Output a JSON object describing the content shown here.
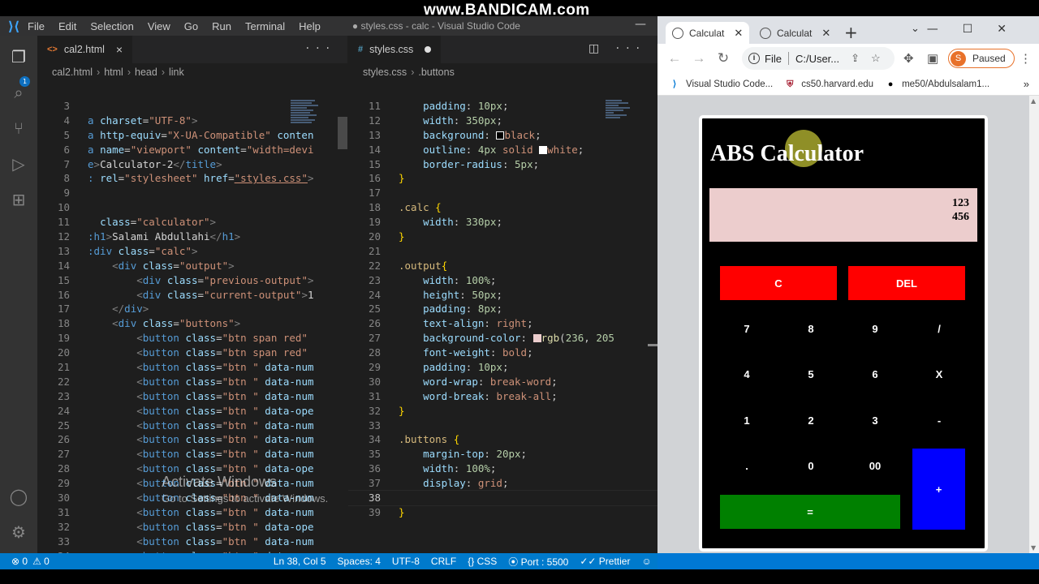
{
  "watermark": "www.BANDICAM.com",
  "vscode": {
    "menu": [
      "File",
      "Edit",
      "Selection",
      "View",
      "Go",
      "Run",
      "Terminal",
      "Help"
    ],
    "title": "● styles.css - calc - Visual Studio Code",
    "explorer_badge": "1",
    "left_editor": {
      "tab_label": "cal2.html",
      "breadcrumb": [
        "cal2.html",
        "html",
        "head",
        "link"
      ],
      "lines": [
        {
          "n": "3",
          "html": ""
        },
        {
          "n": "4",
          "html": "<span style='color:#569cd6'>a</span> <span style='color:#9cdcfe'>charset</span>=<span style='color:#ce9178'>\"UTF-8\"</span><span style='color:#808080'>&gt;</span>"
        },
        {
          "n": "5",
          "html": "<span style='color:#569cd6'>a</span> <span style='color:#9cdcfe'>http-equiv</span>=<span style='color:#ce9178'>\"X-UA-Compatible\"</span> <span style='color:#9cdcfe'>conten</span>"
        },
        {
          "n": "6",
          "html": "<span style='color:#569cd6'>a</span> <span style='color:#9cdcfe'>name</span>=<span style='color:#ce9178'>\"viewport\"</span> <span style='color:#9cdcfe'>content</span>=<span style='color:#ce9178'>\"width=devi</span>"
        },
        {
          "n": "7",
          "html": "<span style='color:#569cd6'>e</span><span style='color:#808080'>&gt;</span><span style='color:#d4d4d4'>Calculator-2</span><span style='color:#808080'>&lt;/</span><span style='color:#569cd6'>title</span><span style='color:#808080'>&gt;</span>"
        },
        {
          "n": "8",
          "html": "<span style='color:#569cd6'>:</span> <span style='color:#9cdcfe'>rel</span>=<span style='color:#ce9178'>\"stylesheet\"</span> <span style='color:#9cdcfe'>href</span>=<span style='color:#ce9178;text-decoration:underline'>\"styles.css\"</span><span style='color:#808080'>&gt;</span>"
        },
        {
          "n": "9",
          "html": ""
        },
        {
          "n": "10",
          "html": ""
        },
        {
          "n": "11",
          "html": "  <span style='color:#9cdcfe'>class</span>=<span style='color:#ce9178'>\"calculator\"</span><span style='color:#808080'>&gt;</span>"
        },
        {
          "n": "12",
          "html": "<span style='color:#569cd6'>:h1</span><span style='color:#808080'>&gt;</span><span style='color:#d4d4d4'>Salami Abdullahi</span><span style='color:#808080'>&lt;/</span><span style='color:#569cd6'>h1</span><span style='color:#808080'>&gt;</span>"
        },
        {
          "n": "13",
          "html": "<span style='color:#569cd6'>:div</span> <span style='color:#9cdcfe'>class</span>=<span style='color:#ce9178'>\"calc\"</span><span style='color:#808080'>&gt;</span>"
        },
        {
          "n": "14",
          "html": "    <span style='color:#808080'>&lt;</span><span style='color:#569cd6'>div</span> <span style='color:#9cdcfe'>class</span>=<span style='color:#ce9178'>\"output\"</span><span style='color:#808080'>&gt;</span>"
        },
        {
          "n": "15",
          "html": "        <span style='color:#808080'>&lt;</span><span style='color:#569cd6'>div</span> <span style='color:#9cdcfe'>class</span>=<span style='color:#ce9178'>\"previous-output\"</span><span style='color:#808080'>&gt;</span>"
        },
        {
          "n": "16",
          "html": "        <span style='color:#808080'>&lt;</span><span style='color:#569cd6'>div</span> <span style='color:#9cdcfe'>class</span>=<span style='color:#ce9178'>\"current-output\"</span><span style='color:#808080'>&gt;</span><span style='color:#d4d4d4'>1</span>"
        },
        {
          "n": "17",
          "html": "    <span style='color:#808080'>&lt;/</span><span style='color:#569cd6'>div</span><span style='color:#808080'>&gt;</span>"
        },
        {
          "n": "18",
          "html": "    <span style='color:#808080'>&lt;</span><span style='color:#569cd6'>div</span> <span style='color:#9cdcfe'>class</span>=<span style='color:#ce9178'>\"buttons\"</span><span style='color:#808080'>&gt;</span>"
        },
        {
          "n": "19",
          "html": "        <span style='color:#808080'>&lt;</span><span style='color:#569cd6'>button</span> <span style='color:#9cdcfe'>class</span>=<span style='color:#ce9178'>\"btn span red\"</span>"
        },
        {
          "n": "20",
          "html": "        <span style='color:#808080'>&lt;</span><span style='color:#569cd6'>button</span> <span style='color:#9cdcfe'>class</span>=<span style='color:#ce9178'>\"btn span red\"</span>"
        },
        {
          "n": "21",
          "html": "        <span style='color:#808080'>&lt;</span><span style='color:#569cd6'>button</span> <span style='color:#9cdcfe'>class</span>=<span style='color:#ce9178'>\"btn \"</span> <span style='color:#9cdcfe'>data-num</span>"
        },
        {
          "n": "22",
          "html": "        <span style='color:#808080'>&lt;</span><span style='color:#569cd6'>button</span> <span style='color:#9cdcfe'>class</span>=<span style='color:#ce9178'>\"btn \"</span> <span style='color:#9cdcfe'>data-num</span>"
        },
        {
          "n": "23",
          "html": "        <span style='color:#808080'>&lt;</span><span style='color:#569cd6'>button</span> <span style='color:#9cdcfe'>class</span>=<span style='color:#ce9178'>\"btn \"</span> <span style='color:#9cdcfe'>data-num</span>"
        },
        {
          "n": "24",
          "html": "        <span style='color:#808080'>&lt;</span><span style='color:#569cd6'>button</span> <span style='color:#9cdcfe'>class</span>=<span style='color:#ce9178'>\"btn \"</span> <span style='color:#9cdcfe'>data-ope</span>"
        },
        {
          "n": "25",
          "html": "        <span style='color:#808080'>&lt;</span><span style='color:#569cd6'>button</span> <span style='color:#9cdcfe'>class</span>=<span style='color:#ce9178'>\"btn \"</span> <span style='color:#9cdcfe'>data-num</span>"
        },
        {
          "n": "26",
          "html": "        <span style='color:#808080'>&lt;</span><span style='color:#569cd6'>button</span> <span style='color:#9cdcfe'>class</span>=<span style='color:#ce9178'>\"btn \"</span> <span style='color:#9cdcfe'>data-num</span>"
        },
        {
          "n": "27",
          "html": "        <span style='color:#808080'>&lt;</span><span style='color:#569cd6'>button</span> <span style='color:#9cdcfe'>class</span>=<span style='color:#ce9178'>\"btn \"</span> <span style='color:#9cdcfe'>data-num</span>"
        },
        {
          "n": "28",
          "html": "        <span style='color:#808080'>&lt;</span><span style='color:#569cd6'>button</span> <span style='color:#9cdcfe'>class</span>=<span style='color:#ce9178'>\"btn \"</span> <span style='color:#9cdcfe'>data-ope</span>"
        },
        {
          "n": "29",
          "html": "        <span style='color:#808080'>&lt;</span><span style='color:#569cd6'>button</span> <span style='color:#9cdcfe'>class</span>=<span style='color:#ce9178'>\"btn \"</span> <span style='color:#9cdcfe'>data-num</span>"
        },
        {
          "n": "30",
          "html": "        <span style='color:#808080'>&lt;</span><span style='color:#569cd6'>button</span> <span style='color:#9cdcfe'>class</span>=<span style='color:#ce9178'>\"btn \"</span> <span style='color:#9cdcfe'>data-num</span>"
        },
        {
          "n": "31",
          "html": "        <span style='color:#808080'>&lt;</span><span style='color:#569cd6'>button</span> <span style='color:#9cdcfe'>class</span>=<span style='color:#ce9178'>\"btn \"</span> <span style='color:#9cdcfe'>data-num</span>"
        },
        {
          "n": "32",
          "html": "        <span style='color:#808080'>&lt;</span><span style='color:#569cd6'>button</span> <span style='color:#9cdcfe'>class</span>=<span style='color:#ce9178'>\"btn \"</span> <span style='color:#9cdcfe'>data-ope</span>"
        },
        {
          "n": "33",
          "html": "        <span style='color:#808080'>&lt;</span><span style='color:#569cd6'>button</span> <span style='color:#9cdcfe'>class</span>=<span style='color:#ce9178'>\"btn \"</span> <span style='color:#9cdcfe'>data-num</span>"
        },
        {
          "n": "34",
          "html": "        <span style='color:#808080'>&lt;</span><span style='color:#569cd6'>button</span> <span style='color:#9cdcfe'>class</span>=<span style='color:#ce9178'>\"btn \"</span> <span style='color:#9cdcfe'>data-num</span>"
        },
        {
          "n": "35",
          "html": "        <span style='color:#808080'>&lt;</span><span style='color:#569cd6'>button</span> <span style='color:#9cdcfe'>class</span>=<span style='color:#ce9178'>\"btn \"</span> <span style='color:#9cdcfe'>data-num</span>"
        }
      ]
    },
    "right_editor": {
      "tab_label": "styles.css",
      "breadcrumb": [
        "styles.css",
        ".buttons"
      ],
      "active_line": "38",
      "lines": [
        {
          "n": "11",
          "html": "    <span style='color:#9cdcfe'>padding</span>: <span style='color:#b5cea8'>10px</span>;"
        },
        {
          "n": "12",
          "html": "    <span style='color:#9cdcfe'>width</span>: <span style='color:#b5cea8'>350px</span>;"
        },
        {
          "n": "13",
          "html": "    <span style='color:#9cdcfe'>background</span>: <span style='display:inline-block;width:10px;height:10px;border:1px solid #fff;background:#000;vertical-align:-1px'></span><span style='color:#ce9178'>black</span>;"
        },
        {
          "n": "14",
          "html": "    <span style='color:#9cdcfe'>outline</span>: <span style='color:#b5cea8'>4px</span> <span style='color:#ce9178'>solid</span> <span style='display:inline-block;width:10px;height:10px;background:#fff;vertical-align:-1px'></span><span style='color:#ce9178'>white</span>;"
        },
        {
          "n": "15",
          "html": "    <span style='color:#9cdcfe'>border-radius</span>: <span style='color:#b5cea8'>5px</span>;"
        },
        {
          "n": "16",
          "html": "<span style='color:#ffd700'>}</span>"
        },
        {
          "n": "17",
          "html": ""
        },
        {
          "n": "18",
          "html": "<span style='color:#d7ba7d'>.calc</span> <span style='color:#ffd700'>{</span>"
        },
        {
          "n": "19",
          "html": "    <span style='color:#9cdcfe'>width</span>: <span style='color:#b5cea8'>330px</span>;"
        },
        {
          "n": "20",
          "html": "<span style='color:#ffd700'>}</span>"
        },
        {
          "n": "21",
          "html": ""
        },
        {
          "n": "22",
          "html": "<span style='color:#d7ba7d'>.output</span><span style='color:#ffd700'>{</span>"
        },
        {
          "n": "23",
          "html": "    <span style='color:#9cdcfe'>width</span>: <span style='color:#b5cea8'>100%</span>;"
        },
        {
          "n": "24",
          "html": "    <span style='color:#9cdcfe'>height</span>: <span style='color:#b5cea8'>50px</span>;"
        },
        {
          "n": "25",
          "html": "    <span style='color:#9cdcfe'>padding</span>: <span style='color:#b5cea8'>8px</span>;"
        },
        {
          "n": "26",
          "html": "    <span style='color:#9cdcfe'>text-align</span>: <span style='color:#ce9178'>right</span>;"
        },
        {
          "n": "27",
          "html": "    <span style='color:#9cdcfe'>background-color</span>: <span style='display:inline-block;width:10px;height:10px;background:rgb(236,205,205);vertical-align:-1px'></span><span style='color:#dcdcaa'>rgb</span>(<span style='color:#b5cea8'>236</span>, <span style='color:#b5cea8'>205</span>"
        },
        {
          "n": "28",
          "html": "    <span style='color:#9cdcfe'>font-weight</span>: <span style='color:#ce9178'>bold</span>;"
        },
        {
          "n": "29",
          "html": "    <span style='color:#9cdcfe'>padding</span>: <span style='color:#b5cea8'>10px</span>;"
        },
        {
          "n": "30",
          "html": "    <span style='color:#9cdcfe'>word-wrap</span>: <span style='color:#ce9178'>break-word</span>;"
        },
        {
          "n": "31",
          "html": "    <span style='color:#9cdcfe'>word-break</span>: <span style='color:#ce9178'>break-all</span>;"
        },
        {
          "n": "32",
          "html": "<span style='color:#ffd700'>}</span>"
        },
        {
          "n": "33",
          "html": ""
        },
        {
          "n": "34",
          "html": "<span style='color:#d7ba7d'>.buttons</span> <span style='color:#ffd700'>{</span>"
        },
        {
          "n": "35",
          "html": "    <span style='color:#9cdcfe'>margin-top</span>: <span style='color:#b5cea8'>20px</span>;"
        },
        {
          "n": "36",
          "html": "    <span style='color:#9cdcfe'>width</span>: <span style='color:#b5cea8'>100%</span>;"
        },
        {
          "n": "37",
          "html": "    <span style='color:#9cdcfe'>display</span>: <span style='color:#ce9178'>grid</span>;"
        },
        {
          "n": "38",
          "html": ""
        },
        {
          "n": "39",
          "html": "<span style='color:#ffd700'>}</span>"
        }
      ]
    },
    "status": {
      "errors": "⊗ 0",
      "warnings": "⚠ 0",
      "position": "Ln 38, Col 5",
      "spaces": "Spaces: 4",
      "encoding": "UTF-8",
      "eol": "CRLF",
      "language": "{} CSS",
      "port": "⦿ Port : 5500",
      "prettier": "✓✓ Prettier"
    }
  },
  "chrome": {
    "tabs": [
      {
        "label": "Calculat"
      },
      {
        "label": "Calculat"
      }
    ],
    "omnibox_scheme": "File",
    "omnibox_url": "C:/User...",
    "profile_initial": "S",
    "profile_status": "Paused",
    "bookmarks": [
      {
        "label": "Visual Studio Code...",
        "icon": "vscode-icon",
        "color": "#0078d4"
      },
      {
        "label": "cs50.harvard.edu",
        "icon": "harvard-shield-icon",
        "color": "#a51c30"
      },
      {
        "label": "me50/Abdulsalam1...",
        "icon": "github-icon",
        "color": "#000000"
      }
    ]
  },
  "calculator": {
    "title": "ABS Calculator",
    "previous_output": "123",
    "current_output": "456",
    "buttons": [
      {
        "label": "C",
        "style": "red"
      },
      {
        "label": "DEL",
        "style": "red"
      },
      {
        "label": "7"
      },
      {
        "label": "8"
      },
      {
        "label": "9"
      },
      {
        "label": "/"
      },
      {
        "label": "4"
      },
      {
        "label": "5"
      },
      {
        "label": "6"
      },
      {
        "label": "X"
      },
      {
        "label": "1"
      },
      {
        "label": "2"
      },
      {
        "label": "3"
      },
      {
        "label": "-"
      },
      {
        "label": "."
      },
      {
        "label": "0"
      },
      {
        "label": "00"
      },
      {
        "label": "+",
        "style": "blue"
      },
      {
        "label": "=",
        "style": "green"
      }
    ]
  },
  "windows_watermark": {
    "line1": "Activate Windows",
    "line2": "Go to Settings to activate Windows."
  }
}
